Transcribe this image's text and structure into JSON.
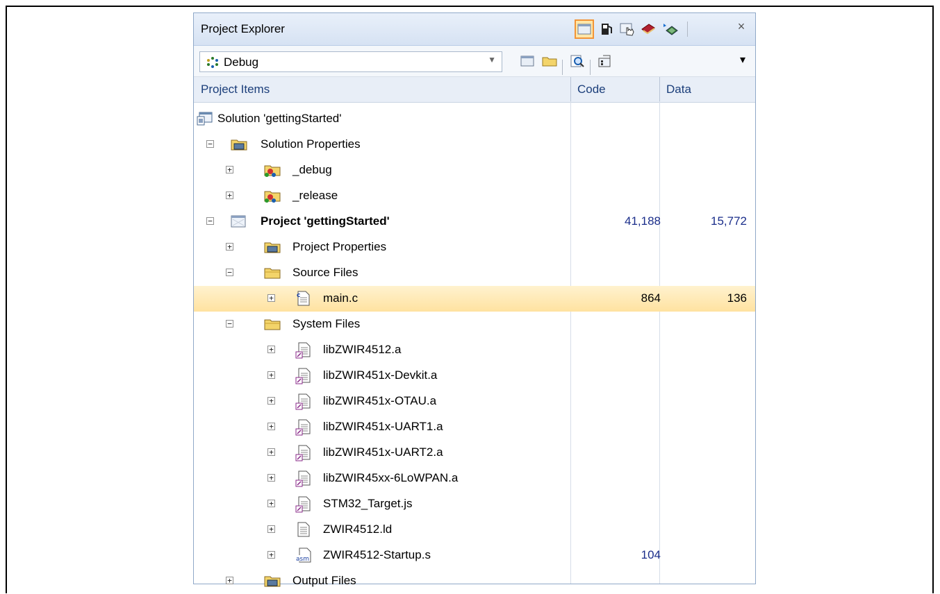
{
  "panel": {
    "title": "Project Explorer",
    "close_glyph": "×",
    "toolbar_icons": [
      "view-icon",
      "fuel-icon",
      "hand-icon",
      "book-icon",
      "chip-icon"
    ],
    "config": {
      "selected": "Debug",
      "icon": "config-cycle-icon"
    },
    "toolbar2_icons": [
      "new-project-icon",
      "folder-icon",
      "find-icon",
      "properties-icon"
    ],
    "overflow_glyph": "▾"
  },
  "columns": {
    "items": "Project Items",
    "code": "Code",
    "data": "Data"
  },
  "tree": [
    {
      "label": "Solution 'gettingStarted'",
      "icon": "solution-icon",
      "level": 0,
      "expander": "",
      "code": "",
      "data": ""
    },
    {
      "label": "Solution Properties",
      "icon": "properties-folder-icon",
      "level": 1,
      "expander": "−",
      "code": "",
      "data": ""
    },
    {
      "label": "_debug",
      "icon": "config-folder-icon",
      "level": 2,
      "expander": "+",
      "code": "",
      "data": ""
    },
    {
      "label": "_release",
      "icon": "config-folder-icon",
      "level": 2,
      "expander": "+",
      "code": "",
      "data": ""
    },
    {
      "label": "Project 'gettingStarted'",
      "icon": "project-icon",
      "level": 1,
      "expander": "−",
      "code": "41,188",
      "data": "15,772",
      "bold": true
    },
    {
      "label": "Project Properties",
      "icon": "properties-folder-icon",
      "level": 2,
      "expander": "+",
      "code": "",
      "data": ""
    },
    {
      "label": "Source Files",
      "icon": "folder-icon",
      "level": 2,
      "expander": "−",
      "code": "",
      "data": ""
    },
    {
      "label": "main.c",
      "icon": "c-file-icon",
      "level": 3,
      "expander": "+",
      "code": "864",
      "data": "136",
      "selected": true
    },
    {
      "label": "System Files",
      "icon": "folder-icon",
      "level": 2,
      "expander": "−",
      "code": "",
      "data": ""
    },
    {
      "label": "libZWIR4512.a",
      "icon": "library-file-icon",
      "level": 3,
      "expander": "+",
      "code": "",
      "data": ""
    },
    {
      "label": "libZWIR451x-Devkit.a",
      "icon": "library-file-icon",
      "level": 3,
      "expander": "+",
      "code": "",
      "data": ""
    },
    {
      "label": "libZWIR451x-OTAU.a",
      "icon": "library-file-icon",
      "level": 3,
      "expander": "+",
      "code": "",
      "data": ""
    },
    {
      "label": "libZWIR451x-UART1.a",
      "icon": "library-file-icon",
      "level": 3,
      "expander": "+",
      "code": "",
      "data": ""
    },
    {
      "label": "libZWIR451x-UART2.a",
      "icon": "library-file-icon",
      "level": 3,
      "expander": "+",
      "code": "",
      "data": ""
    },
    {
      "label": "libZWIR45xx-6LoWPAN.a",
      "icon": "library-file-icon",
      "level": 3,
      "expander": "+",
      "code": "",
      "data": ""
    },
    {
      "label": "STM32_Target.js",
      "icon": "library-file-icon",
      "level": 3,
      "expander": "+",
      "code": "",
      "data": ""
    },
    {
      "label": "ZWIR4512.ld",
      "icon": "text-file-icon",
      "level": 3,
      "expander": "+",
      "code": "",
      "data": ""
    },
    {
      "label": "ZWIR4512-Startup.s",
      "icon": "asm-file-icon",
      "level": 3,
      "expander": "+",
      "code": "104",
      "data": ""
    },
    {
      "label": "Output Files",
      "icon": "properties-folder-icon",
      "level": 2,
      "expander": "+",
      "code": "",
      "data": ""
    }
  ],
  "icon_text": {
    "asm": "asm",
    "c": "c"
  },
  "colors": {
    "selection": "#ffe2a0",
    "number": "#1a2d8a",
    "header_text": "#1b3e7a",
    "active_tool": "#f29436"
  }
}
